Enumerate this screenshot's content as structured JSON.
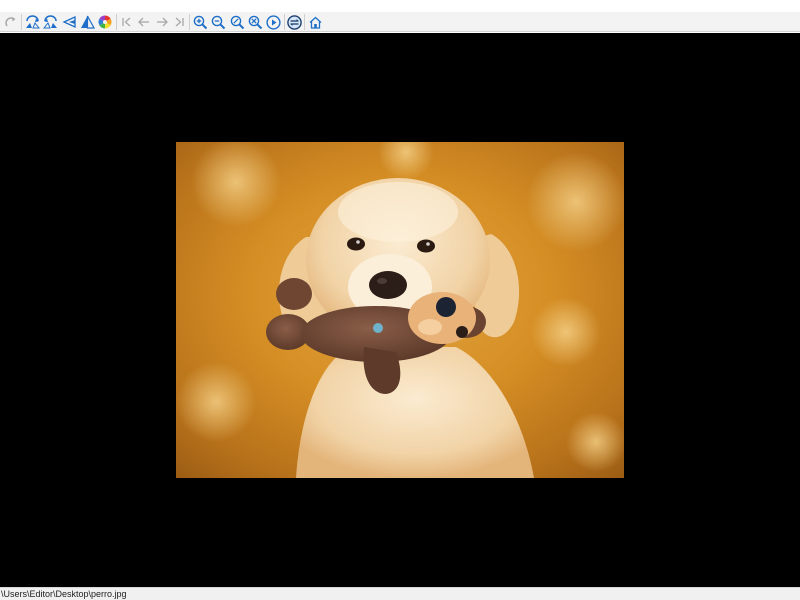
{
  "toolbar": {
    "buttons": [
      {
        "icon": "redo-icon",
        "enabled": false
      },
      {
        "icon": "flip-horizontal-icon",
        "enabled": true
      },
      {
        "icon": "flip-vertical-icon",
        "enabled": true
      },
      {
        "icon": "mirror-icon",
        "enabled": true
      },
      {
        "icon": "sharpen-icon",
        "enabled": true
      },
      {
        "icon": "color-wheel-icon",
        "enabled": true
      },
      {
        "icon": "first-image-icon",
        "enabled": false
      },
      {
        "icon": "previous-image-icon",
        "enabled": false
      },
      {
        "icon": "next-image-icon",
        "enabled": false
      },
      {
        "icon": "last-image-icon",
        "enabled": false
      },
      {
        "icon": "zoom-in-icon",
        "enabled": true
      },
      {
        "icon": "zoom-out-icon",
        "enabled": true
      },
      {
        "icon": "zoom-fit-icon",
        "enabled": true
      },
      {
        "icon": "zoom-actual-icon",
        "enabled": true
      },
      {
        "icon": "slideshow-play-icon",
        "enabled": true
      },
      {
        "icon": "fit-toggle-icon",
        "enabled": true
      },
      {
        "icon": "home-icon",
        "enabled": true
      }
    ],
    "accent_color": "#1e6fc9",
    "disabled_color": "#a9a9a9"
  },
  "viewer": {
    "background": "#000000",
    "image_subject": "golden retriever puppy holding a brown teddy bear toy"
  },
  "statusbar": {
    "path": "\\Users\\Editor\\Desktop\\perro.jpg"
  }
}
